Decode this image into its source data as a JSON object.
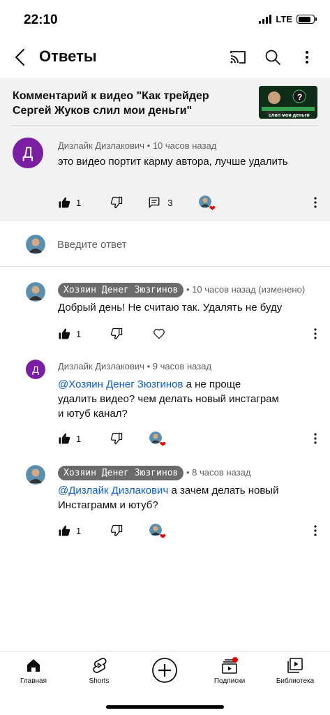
{
  "status_bar": {
    "time": "22:10",
    "network": "LTE",
    "battery_level": 0.85
  },
  "header": {
    "title": "Ответы"
  },
  "video": {
    "title": "Комментарий к видео \"Как трейдер Сергей Жуков слил мои деньги\"",
    "thumbnail_caption": "слил мои деньги"
  },
  "main_comment": {
    "avatar_letter": "Д",
    "author": "Дизлайк Дизлакович",
    "time": "10 часов назад",
    "text": "это видео портит карму автора, лучше удалить",
    "likes": "1",
    "replies": "3",
    "accent_color": "#7b1fa2"
  },
  "reply_input": {
    "placeholder": "Введите ответ"
  },
  "replies": [
    {
      "author": "Хозяин Денег Зюзгинов",
      "time": "10 часов назад (изменено)",
      "text": "Добрый день! Не считаю так. Удалять не буду",
      "likes": "1"
    },
    {
      "avatar_letter": "Д",
      "author": "Дизлайк Дизлакович",
      "time": "9 часов назад",
      "mention": "@Хозяин Денег Зюзгинов",
      "text": "а не проще удалить видео? чем делать новый инстаграм и ютуб канал?",
      "likes": "1"
    },
    {
      "author": "Хозяин Денег Зюзгинов",
      "time": "8 часов назад",
      "mention": "@Дизлайк Дизлакович",
      "text": "а зачем делать новый Инстаграмм и ютуб?",
      "likes": "1"
    }
  ],
  "nav": {
    "home": "Главная",
    "shorts": "Shorts",
    "subscriptions": "Подписки",
    "library": "Библиотека"
  },
  "colors": {
    "mention": "#065fd4",
    "heart": "#e00000",
    "owner_chip": "#6b6b6b"
  }
}
